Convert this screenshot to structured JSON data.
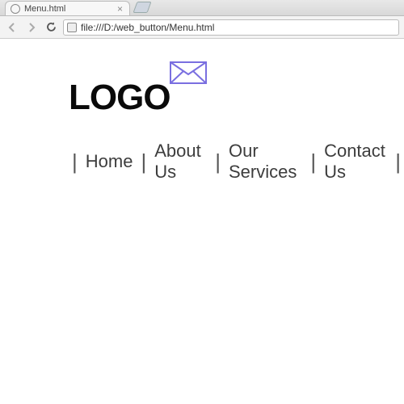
{
  "browser": {
    "tab_title": "Menu.html",
    "url": "file:///D:/web_button/Menu.html"
  },
  "page": {
    "logo_text": "LOGO",
    "menu": [
      {
        "label": "Home"
      },
      {
        "label": "About Us"
      },
      {
        "label": "Our Services"
      },
      {
        "label": "Contact Us"
      }
    ]
  }
}
